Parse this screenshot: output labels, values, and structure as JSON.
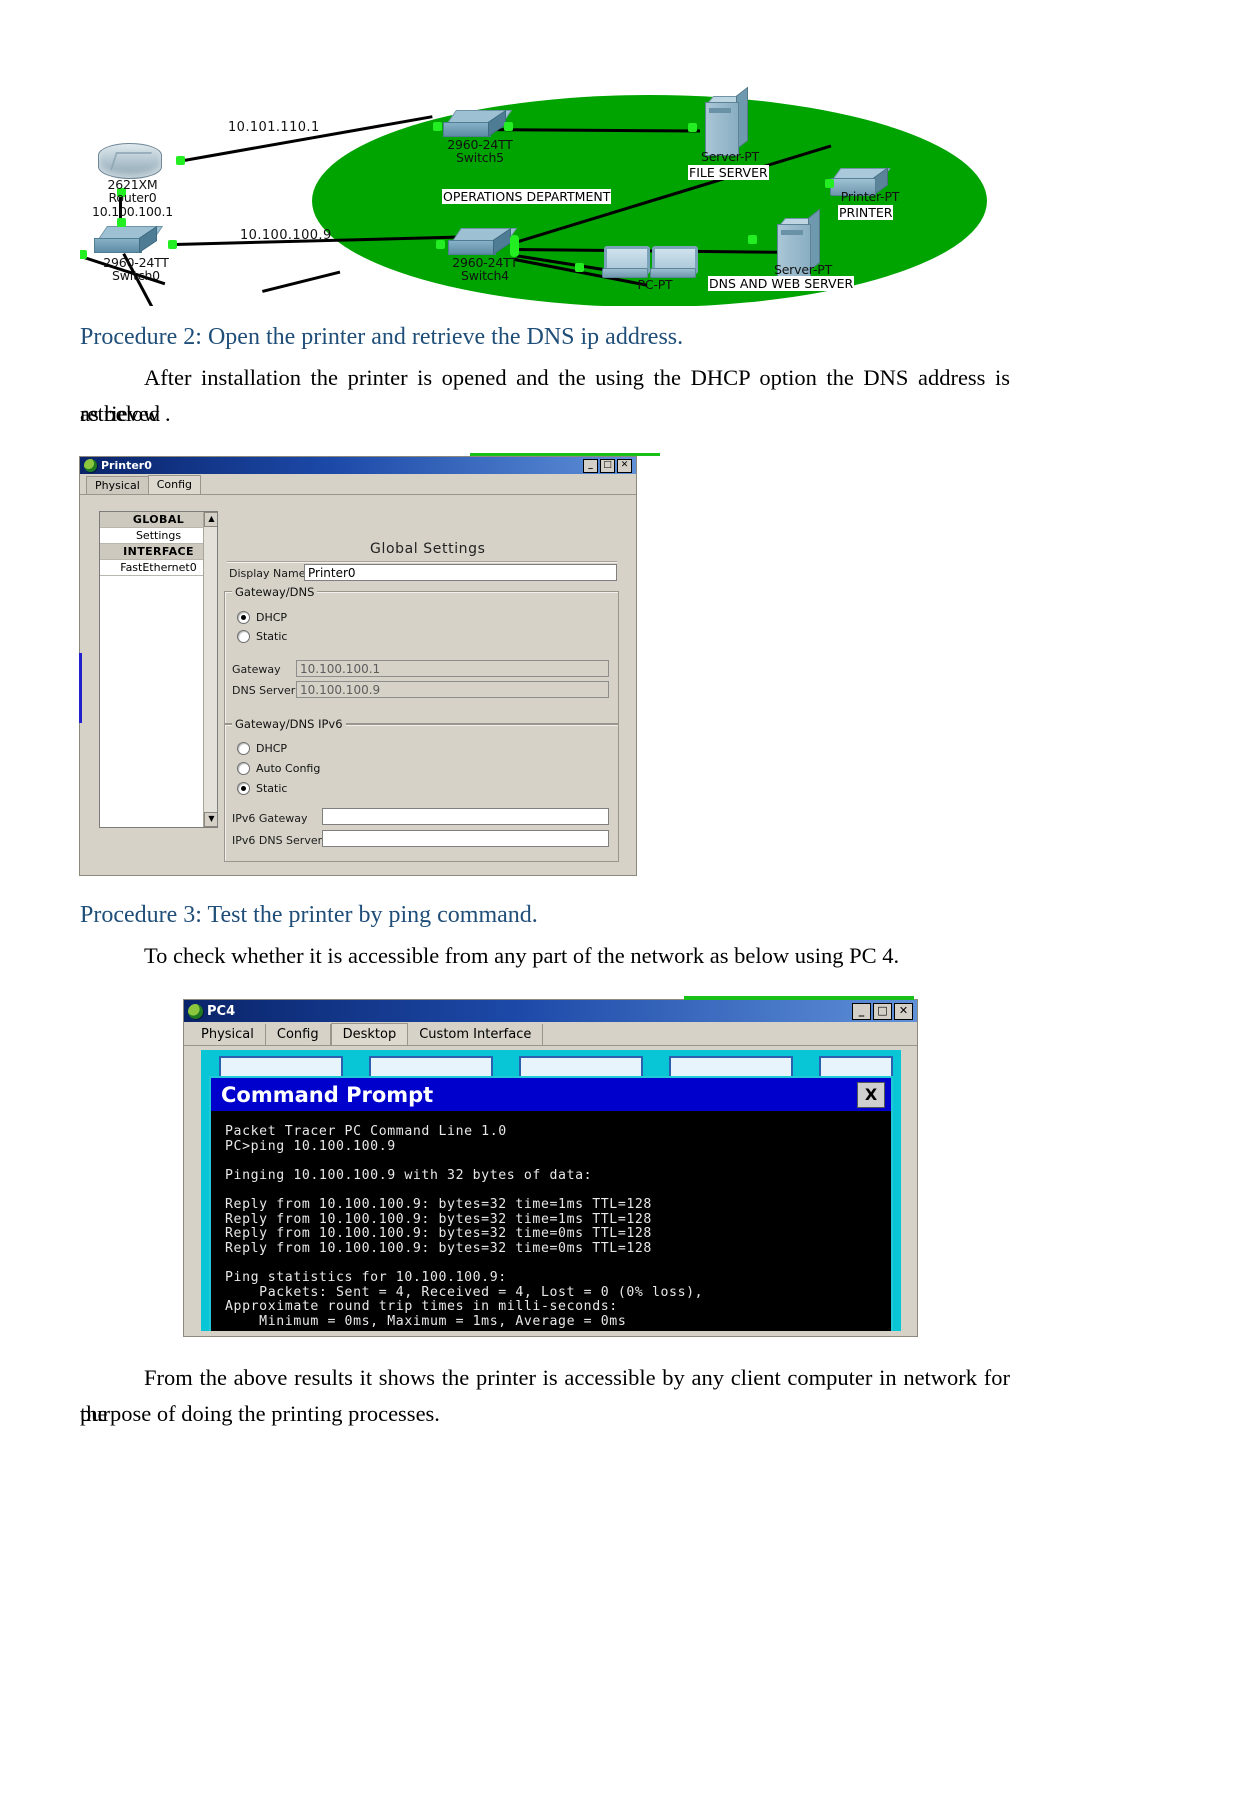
{
  "diagram": {
    "cloud_label": "OPERATIONS DEPARTMENT",
    "links": [
      {
        "label": "10.101.110.1"
      },
      {
        "label": "10.100.100.9"
      }
    ],
    "devices": [
      {
        "model": "2621XM",
        "name": "Router0",
        "ip": "10.100.100.1"
      },
      {
        "model": "2960-24TT",
        "name": "Switch0"
      },
      {
        "model": "2960-24TT",
        "name": "Switch5"
      },
      {
        "model": "2960-24TT",
        "name": "Switch4"
      },
      {
        "model": "Server-PT",
        "name": "FILE SERVER"
      },
      {
        "model": "Printer-PT",
        "name": "PRINTER"
      },
      {
        "model": "Server-PT",
        "name": "DNS AND WEB SERVER"
      },
      {
        "model": "PC-PT",
        "name": "PC-PT"
      }
    ]
  },
  "doc": {
    "procedure2_heading": "Procedure 2: Open the printer and retrieve the DNS ip address.",
    "procedure2_body_line1": "After installation the printer is opened and the using the DHCP option the DNS address is retrieved",
    "procedure2_body_line2": "as below  .",
    "procedure3_heading": "Procedure 3: Test the printer by ping command.",
    "procedure3_body": "To check whether it  is accessible from any part of the network as below using PC 4.",
    "closing_line1": "From  the above results it shows the printer is accessible by any client computer in network for the",
    "closing_line2": "purpose of doing the printing processes."
  },
  "printer_window": {
    "title": "Printer0",
    "controls": {
      "minimize": "_",
      "maximize": "□",
      "close": "✕"
    },
    "tabs": [
      {
        "label": "Physical",
        "active": false
      },
      {
        "label": "Config",
        "active": true
      }
    ],
    "sidebar": [
      {
        "label": "GLOBAL",
        "type": "header"
      },
      {
        "label": "Settings",
        "type": "item"
      },
      {
        "label": "INTERFACE",
        "type": "header"
      },
      {
        "label": "FastEthernet0",
        "type": "item"
      }
    ],
    "panel_title": "Global Settings",
    "display_name_label": "Display Name",
    "display_name_value": "Printer0",
    "gateway_dns": {
      "group_title": "Gateway/DNS",
      "dhcp_label": "DHCP",
      "static_label": "Static",
      "selected": "DHCP",
      "gateway_label": "Gateway",
      "gateway_value": "10.100.100.1",
      "dns_label": "DNS Server",
      "dns_value": "10.100.100.9"
    },
    "gateway_dns_ipv6": {
      "group_title": "Gateway/DNS IPv6",
      "dhcp_label": "DHCP",
      "auto_config_label": "Auto Config",
      "static_label": "Static",
      "selected": "Static",
      "gateway_label": "IPv6 Gateway",
      "gateway_value": "",
      "dns_label": "IPv6 DNS Server",
      "dns_value": ""
    }
  },
  "pc_window": {
    "title": "PC4",
    "controls": {
      "minimize": "_",
      "maximize": "□",
      "close": "✕"
    },
    "tabs": [
      {
        "label": "Physical",
        "active": false
      },
      {
        "label": "Config",
        "active": false
      },
      {
        "label": "Desktop",
        "active": true
      },
      {
        "label": "Custom Interface",
        "active": false
      }
    ],
    "command_prompt": {
      "title": "Command Prompt",
      "close_label": "X",
      "output": "Packet Tracer PC Command Line 1.0\nPC>ping 10.100.100.9\n\nPinging 10.100.100.9 with 32 bytes of data:\n\nReply from 10.100.100.9: bytes=32 time=1ms TTL=128\nReply from 10.100.100.9: bytes=32 time=1ms TTL=128\nReply from 10.100.100.9: bytes=32 time=0ms TTL=128\nReply from 10.100.100.9: bytes=32 time=0ms TTL=128\n\nPing statistics for 10.100.100.9:\n    Packets: Sent = 4, Received = 4, Lost = 0 (0% loss),\nApproximate round trip times in milli-seconds:\n    Minimum = 0ms, Maximum = 1ms, Average = 0ms"
    }
  },
  "colors": {
    "cloud_green": "#00a400",
    "heading_blue": "#1f4e79",
    "titlebar_blue": "#0a246a",
    "cmd_blue": "#0000cc"
  }
}
